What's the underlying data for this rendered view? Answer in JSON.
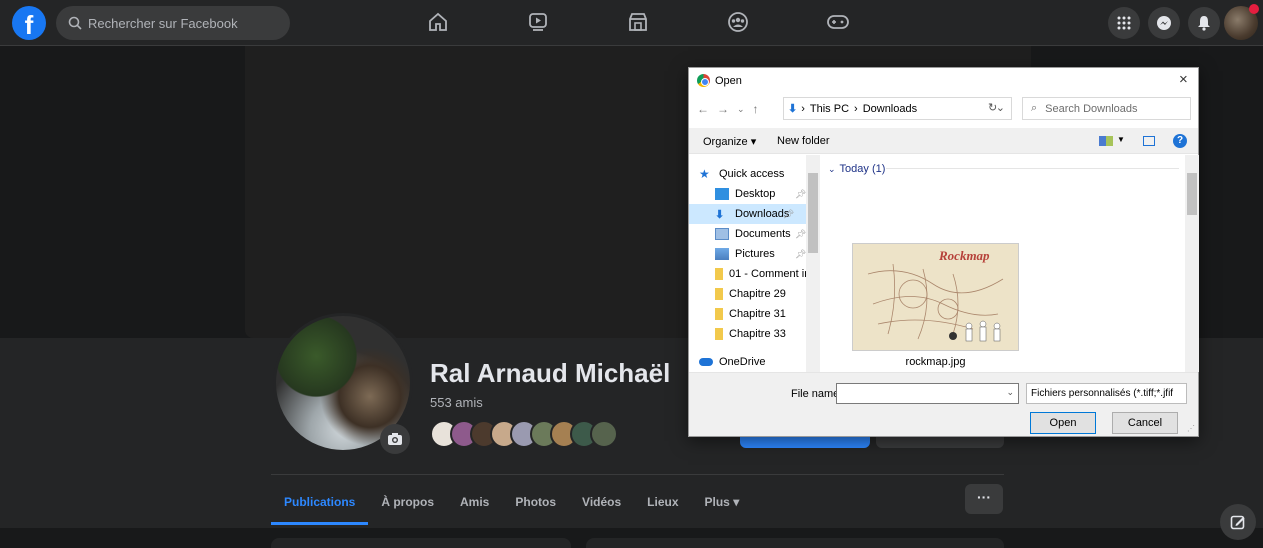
{
  "fb": {
    "search_placeholder": "Rechercher sur Facebook",
    "logo_letter": "f"
  },
  "profile": {
    "name": "Ral Arnaud Michaël",
    "friends": "553 amis"
  },
  "tabs": [
    "Publications",
    "À propos",
    "Amis",
    "Photos",
    "Vidéos",
    "Lieux",
    "Plus ▾"
  ],
  "more_label": "···",
  "dialog": {
    "title": "Open",
    "close": "×",
    "breadcrumbs": [
      "This PC",
      "Downloads"
    ],
    "search_placeholder": "Search Downloads",
    "organize": "Organize ▾",
    "new_folder": "New folder",
    "nav_items": [
      {
        "label": "Quick access"
      },
      {
        "label": "Desktop"
      },
      {
        "label": "Downloads"
      },
      {
        "label": "Documents"
      },
      {
        "label": "Pictures"
      },
      {
        "label": "01 - Comment ir"
      },
      {
        "label": "Chapitre 29"
      },
      {
        "label": "Chapitre 31"
      },
      {
        "label": "Chapitre 33"
      },
      {
        "label": "OneDrive"
      }
    ],
    "group_header": "Today (1)",
    "file_name": "rockmap.jpg",
    "thumbnail_title": "Rockmap",
    "file_name_label": "File name:",
    "file_name_value": "",
    "filter": "Fichiers personnalisés (*.tiff;*.jfif",
    "open_btn": "Open",
    "cancel_btn": "Cancel"
  },
  "colors": {
    "fb_blue": "#1877f2",
    "accent": "#2d88ff",
    "dark_bg": "#18191a",
    "card_bg": "#242526"
  },
  "icons": [
    "home-icon",
    "watch-icon",
    "marketplace-icon",
    "groups-icon",
    "gaming-icon",
    "menu-grid-icon",
    "messenger-icon",
    "bell-icon",
    "camera-icon",
    "compose-icon",
    "help-icon",
    "star-icon",
    "folder-icon"
  ]
}
